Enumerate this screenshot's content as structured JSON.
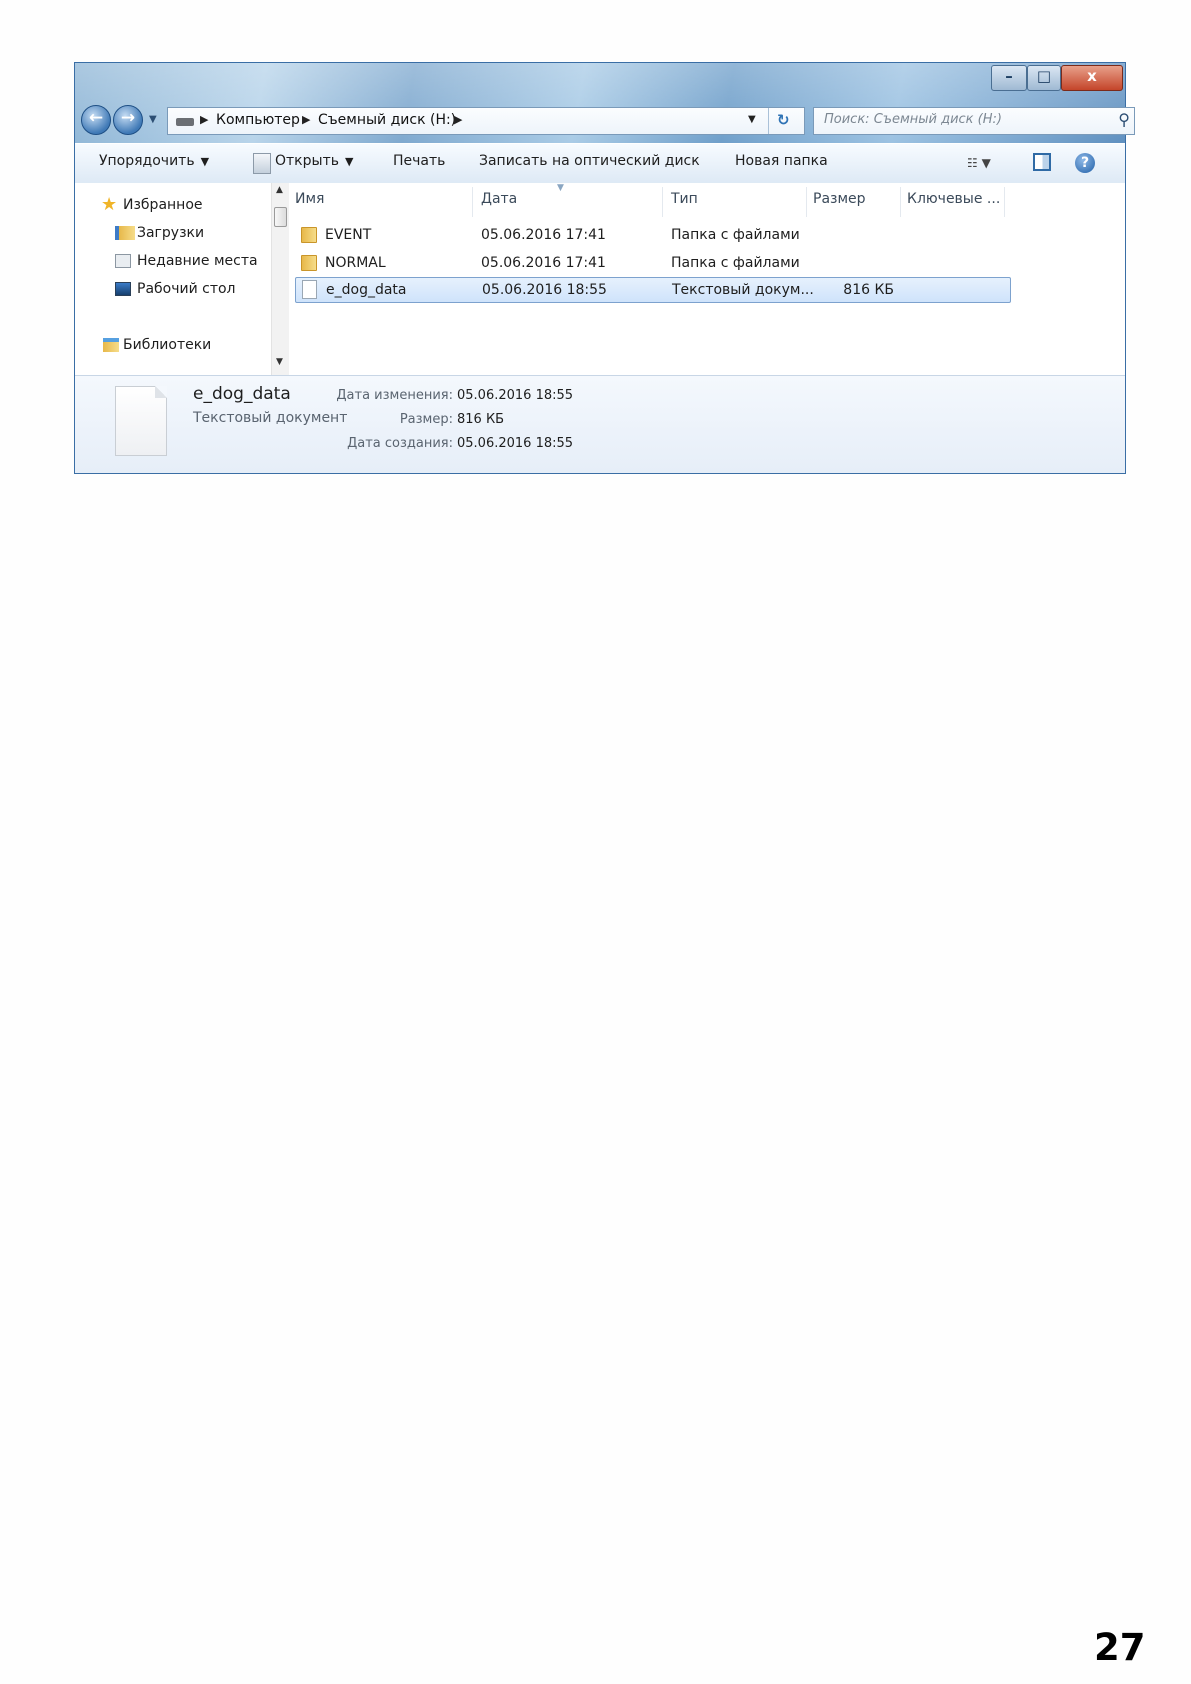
{
  "window": {
    "buttons": {
      "minimize": "–",
      "maximize": "□",
      "close": "x"
    }
  },
  "nav": {
    "back_icon": "back-arrow-icon",
    "forward_icon": "forward-arrow-icon",
    "history_icon": "history-dropdown-icon"
  },
  "address": {
    "crumbs": [
      "Компьютер",
      "Съемный диск (H:)"
    ],
    "refresh_icon": "refresh-icon"
  },
  "search": {
    "placeholder": "Поиск: Съемный диск (H:)",
    "icon": "search-icon"
  },
  "toolbar": {
    "organize": "Упорядочить",
    "open": "Открыть",
    "print": "Печать",
    "burn": "Записать на оптический диск",
    "new_folder": "Новая папка"
  },
  "navpane": {
    "favorites": "Избранное",
    "downloads": "Загрузки",
    "recent": "Недавние места",
    "desktop": "Рабочий стол",
    "libraries": "Библиотеки"
  },
  "columns": {
    "name": "Имя",
    "date": "Дата",
    "type": "Тип",
    "size": "Размер",
    "keywords": "Ключевые ..."
  },
  "files": [
    {
      "name": "EVENT",
      "date": "05.06.2016 17:41",
      "type": "Папка с файлами",
      "size": "",
      "icon": "folder-icon"
    },
    {
      "name": "NORMAL",
      "date": "05.06.2016 17:41",
      "type": "Папка с файлами",
      "size": "",
      "icon": "folder-icon"
    },
    {
      "name": "e_dog_data",
      "date": "05.06.2016 18:55",
      "type": "Текстовый докум...",
      "size": "816 КБ",
      "icon": "text-document-icon",
      "selected": true
    }
  ],
  "details": {
    "name": "e_dog_data",
    "type": "Текстовый документ",
    "modified_label": "Дата изменения:",
    "modified_value": "05.06.2016 18:55",
    "size_label": "Размер:",
    "size_value": "816 КБ",
    "created_label": "Дата создания:",
    "created_value": "05.06.2016 18:55"
  },
  "page_number": "27"
}
